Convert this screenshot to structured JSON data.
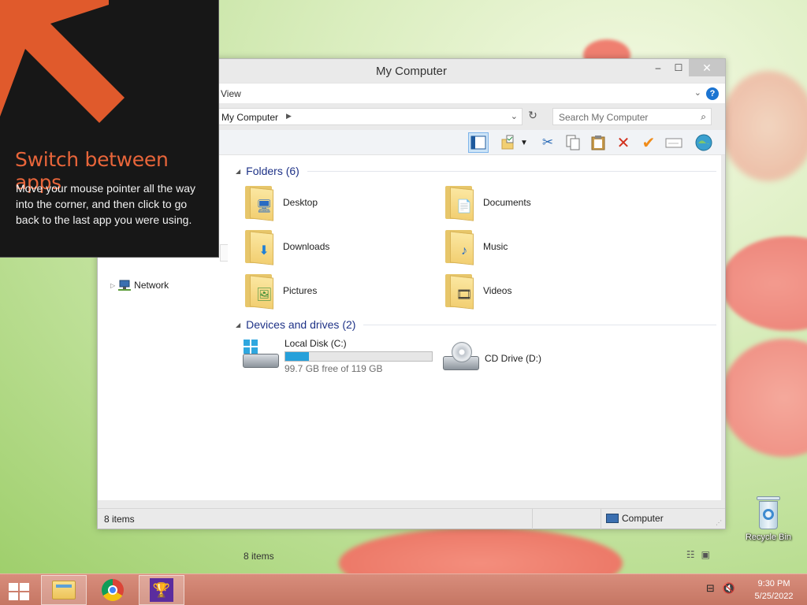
{
  "window": {
    "title": "My Computer",
    "minimize_glyph": "‒",
    "maximize_glyph": "☐",
    "close_glyph": "✕"
  },
  "menubar": {
    "view_label": "View",
    "help_glyph": "?"
  },
  "address": {
    "path_label": "My Computer",
    "search_placeholder": "Search My Computer"
  },
  "nav": {
    "network_label": "Network"
  },
  "groups": {
    "folders_label": "Folders (6)",
    "drives_label": "Devices and drives (2)"
  },
  "folders": [
    {
      "label": "Desktop",
      "icon": "desktop-folder-icon",
      "badge": "🖥"
    },
    {
      "label": "Documents",
      "icon": "documents-folder-icon",
      "badge": "📄"
    },
    {
      "label": "Downloads",
      "icon": "downloads-folder-icon",
      "badge": "⬇"
    },
    {
      "label": "Music",
      "icon": "music-folder-icon",
      "badge": "♪"
    },
    {
      "label": "Pictures",
      "icon": "pictures-folder-icon",
      "badge": "🖼"
    },
    {
      "label": "Videos",
      "icon": "videos-folder-icon",
      "badge": "🎞"
    }
  ],
  "drives": [
    {
      "label": "Local Disk (C:)",
      "free_text": "99.7 GB free of 119 GB",
      "used_fraction": 0.162
    },
    {
      "label": "CD Drive (D:)"
    }
  ],
  "content_status": "8 items",
  "statusbar": {
    "items": "8 items",
    "location": "Computer"
  },
  "tip": {
    "title": "Switch between apps",
    "body": "Move your mouse pointer all the way into the corner, and then click to go back to the last app you were using."
  },
  "desktop": {
    "recycle_bin_label": "Recycle Bin"
  },
  "taskbar": {
    "time": "9:30 PM",
    "date": "5/25/2022"
  },
  "colors": {
    "accent": "#26a0da",
    "tip_title": "#e8653a",
    "taskbar": "#c57663"
  }
}
